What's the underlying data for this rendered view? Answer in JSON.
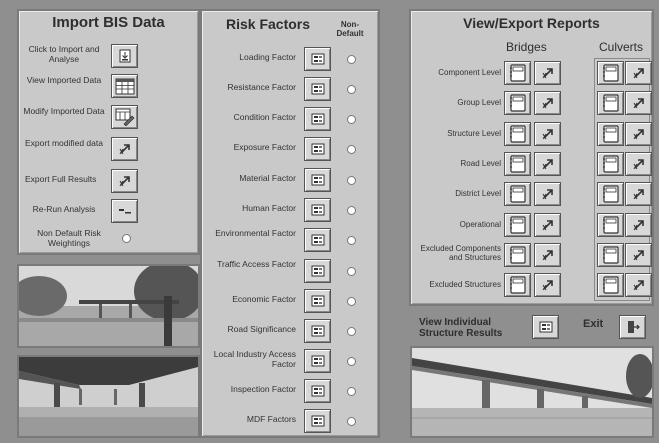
{
  "import_panel": {
    "title": "Import BIS Data",
    "click_import": "Click to Import and Analyse",
    "view_imported": "View Imported Data",
    "modify_imported": "Modify Imported Data",
    "export_modified": "Export modified data",
    "export_full": "Export Full Results",
    "rerun": "Re-Run Analysis",
    "non_default": "Non Default Risk Weightings"
  },
  "risk_panel": {
    "title": "Risk Factors",
    "non_default_header": "Non-Default",
    "factors": [
      "Loading Factor",
      "Resistance Factor",
      "Condition Factor",
      "Exposure Factor",
      "Material Factor",
      "Human Factor",
      "Environmental Factor",
      "Traffic Access Factor",
      "Economic Factor",
      "Road Significance",
      "Local Industry Access Factor",
      "Inspection Factor",
      "MDF Factors"
    ]
  },
  "reports_panel": {
    "title": "View/Export Reports",
    "bridges": "Bridges",
    "culverts": "Culverts",
    "rows": [
      "Component Level",
      "Group Level",
      "Structure Level",
      "Road Level",
      "District Level",
      "Operational",
      "Excluded Components and Structures",
      "Excluded Structures"
    ]
  },
  "bottom": {
    "view_individual": "View Individual Structure Results",
    "exit": "Exit"
  },
  "icons": {
    "import": "import-icon",
    "table": "table-icon",
    "modify": "modify-icon",
    "export": "export-icon",
    "form": "form-icon",
    "report": "report-icon",
    "exit": "exit-door-icon"
  }
}
